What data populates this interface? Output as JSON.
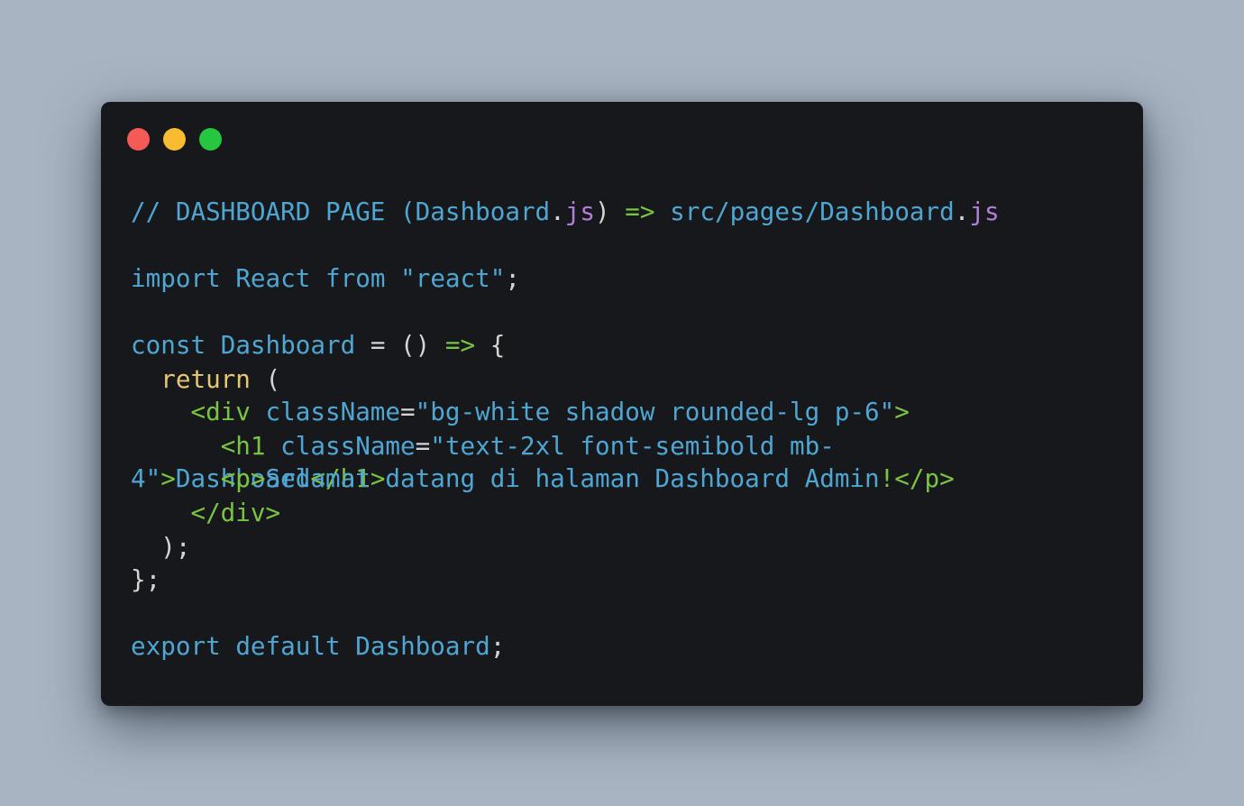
{
  "window": {
    "traffic_lights": [
      {
        "name": "close",
        "color": "#f45b55"
      },
      {
        "name": "minimize",
        "color": "#f7bc2f"
      },
      {
        "name": "zoom",
        "color": "#27c63f"
      }
    ]
  },
  "code": {
    "lines": [
      [
        {
          "t": "// DASHBOARD PAGE (",
          "c": "id"
        },
        {
          "t": "Dashboard",
          "c": "id"
        },
        {
          "t": ".",
          "c": "plain"
        },
        {
          "t": "js",
          "c": "prop"
        },
        {
          "t": ") ",
          "c": "plain"
        },
        {
          "t": "=>",
          "c": "arrow"
        },
        {
          "t": " src/pages/",
          "c": "id"
        },
        {
          "t": "Dashboard",
          "c": "id"
        },
        {
          "t": ".",
          "c": "plain"
        },
        {
          "t": "js",
          "c": "prop"
        }
      ],
      [],
      [
        {
          "t": "import",
          "c": "kw"
        },
        {
          "t": " ",
          "c": "plain"
        },
        {
          "t": "React",
          "c": "id"
        },
        {
          "t": " ",
          "c": "plain"
        },
        {
          "t": "from",
          "c": "kw"
        },
        {
          "t": " ",
          "c": "plain"
        },
        {
          "t": "\"react\"",
          "c": "str"
        },
        {
          "t": ";",
          "c": "plain"
        }
      ],
      [],
      [
        {
          "t": "const",
          "c": "kw"
        },
        {
          "t": " ",
          "c": "plain"
        },
        {
          "t": "Dashboard",
          "c": "id"
        },
        {
          "t": " = () ",
          "c": "plain"
        },
        {
          "t": "=>",
          "c": "arrow"
        },
        {
          "t": " {",
          "c": "plain"
        }
      ],
      [
        {
          "t": "  ",
          "c": "plain"
        },
        {
          "t": "return",
          "c": "ret"
        },
        {
          "t": " (",
          "c": "plain"
        }
      ],
      [
        {
          "t": "    ",
          "c": "plain"
        },
        {
          "t": "<div",
          "c": "tag"
        },
        {
          "t": " className",
          "c": "id"
        },
        {
          "t": "=",
          "c": "plain"
        },
        {
          "t": "\"bg-white shadow rounded-lg p-6\"",
          "c": "str"
        },
        {
          "t": ">",
          "c": "tag"
        }
      ],
      [
        {
          "t": "      ",
          "c": "plain"
        },
        {
          "t": "<h1",
          "c": "tag"
        },
        {
          "t": " className",
          "c": "id"
        },
        {
          "t": "=",
          "c": "plain"
        },
        {
          "t": "\"text-2xl font-semibold mb-",
          "c": "str"
        }
      ],
      [
        {
          "t": "4\"",
          "c": "str"
        },
        {
          "t": ">",
          "c": "tag"
        },
        {
          "t": "Dashboard",
          "c": "text"
        },
        {
          "t": "</h1>",
          "c": "tag"
        }
      ],
      [
        {
          "t": "    ",
          "c": "plain"
        },
        {
          "t": "</div>",
          "c": "tag"
        }
      ],
      [
        {
          "t": "  );",
          "c": "plain"
        }
      ],
      [
        {
          "t": "};",
          "c": "plain"
        }
      ],
      [],
      [
        {
          "t": "export",
          "c": "kw"
        },
        {
          "t": " ",
          "c": "plain"
        },
        {
          "t": "default",
          "c": "kw"
        },
        {
          "t": " ",
          "c": "plain"
        },
        {
          "t": "Dashboard",
          "c": "id"
        },
        {
          "t": ";",
          "c": "plain"
        }
      ]
    ],
    "overlap_line": [
      {
        "t": "      ",
        "c": "plain"
      },
      {
        "t": "<p>",
        "c": "tag"
      },
      {
        "t": "Selamat datang di halaman Dashboard Admin",
        "c": "text"
      },
      {
        "t": "!",
        "c": "bang"
      },
      {
        "t": "</p>",
        "c": "tag"
      }
    ]
  }
}
